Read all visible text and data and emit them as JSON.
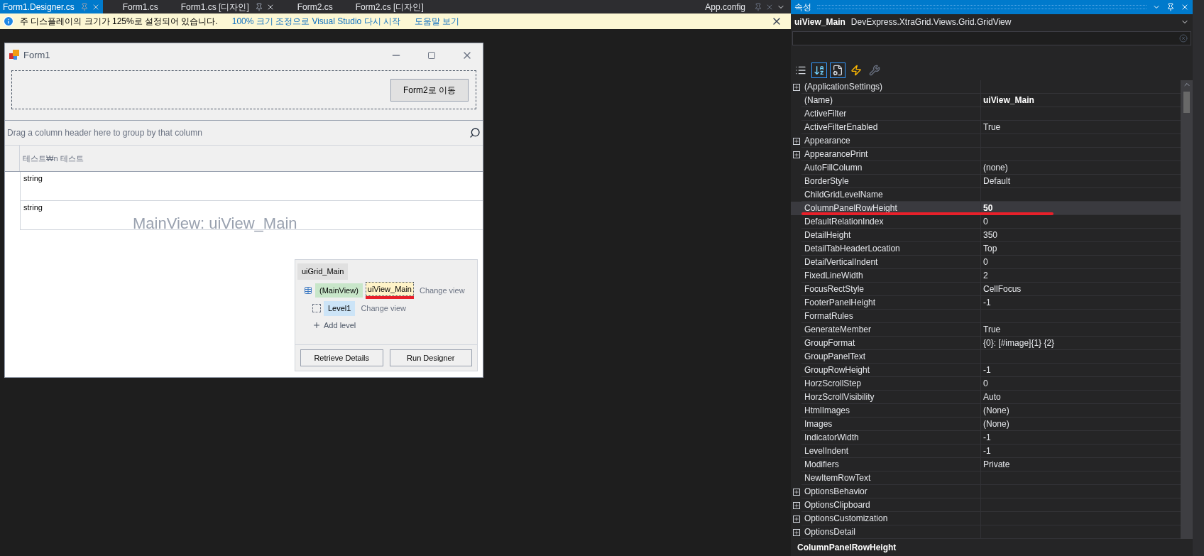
{
  "tabs": [
    {
      "label": "Form1.Designer.cs",
      "selected": true,
      "closable": true
    },
    {
      "label": "Form1.cs",
      "selected": false,
      "closable": false
    },
    {
      "label": "Form1.cs [디자인]",
      "selected": false,
      "closable": true
    },
    {
      "label": "Form2.cs",
      "selected": false,
      "closable": false
    },
    {
      "label": "Form2.cs [디자인]",
      "selected": false,
      "closable": false
    }
  ],
  "right_tab": {
    "label": "App.config"
  },
  "info_bar": {
    "message": "주 디스플레이의 크기가 125%로 설정되어 있습니다.",
    "links": [
      "100% 크기 조정으로 Visual Studio 다시 시작",
      "도움말 보기"
    ]
  },
  "form": {
    "title": "Form1",
    "button": "Form2로 이동",
    "grid": {
      "group_panel_text": "Drag a column header here to group by that column",
      "columns": [
        "테스트₩n 테스트"
      ],
      "rows": [
        "string",
        "string"
      ],
      "overlay": "MainView: uiView_Main"
    },
    "designer": {
      "grid_name": "uiGrid_Main",
      "levels": [
        {
          "label": "(MainView)",
          "color": "#c8e6c9",
          "view": {
            "label": "uiView_Main",
            "underlined": true
          },
          "action": "Change view"
        },
        {
          "label": "Level1",
          "color": "#cce4f7",
          "action": "Change view"
        }
      ],
      "add_level": "Add level",
      "buttons": [
        "Retrieve Details",
        "Run Designer"
      ]
    }
  },
  "properties": {
    "title": "속성",
    "object_name": "uiView_Main",
    "object_type": "DevExpress.XtraGrid.Views.Grid.GridView",
    "toolbar": [
      {
        "kind": "categorized",
        "selected": false
      },
      {
        "kind": "alphabetical",
        "selected": true
      },
      {
        "kind": "properties",
        "selected": true
      },
      {
        "kind": "events",
        "selected": false
      },
      {
        "kind": "pages",
        "selected": false
      }
    ],
    "rows": [
      {
        "name": "(ApplicationSettings)",
        "expandable": true,
        "selected": false,
        "underlined": false
      },
      {
        "name": "(Name)",
        "value": "uiView_Main",
        "expandable": false,
        "modified": true,
        "selected": false,
        "underlined": false
      },
      {
        "name": "ActiveFilter",
        "expandable": false,
        "selected": false,
        "underlined": false
      },
      {
        "name": "ActiveFilterEnabled",
        "value": "True",
        "expandable": false,
        "modified": false,
        "selected": false,
        "underlined": false
      },
      {
        "name": "Appearance",
        "expandable": true,
        "selected": false,
        "underlined": false
      },
      {
        "name": "AppearancePrint",
        "expandable": true,
        "selected": false,
        "underlined": false
      },
      {
        "name": "AutoFillColumn",
        "value": "(none)",
        "expandable": false,
        "modified": false,
        "selected": false,
        "underlined": false
      },
      {
        "name": "BorderStyle",
        "value": "Default",
        "expandable": false,
        "modified": false,
        "selected": false,
        "underlined": false
      },
      {
        "name": "ChildGridLevelName",
        "expandable": false,
        "selected": false,
        "underlined": false
      },
      {
        "name": "ColumnPanelRowHeight",
        "value": "50",
        "expandable": false,
        "modified": true,
        "selected": true,
        "underlined": true
      },
      {
        "name": "DefaultRelationIndex",
        "value": "0",
        "expandable": false,
        "modified": false,
        "selected": false,
        "underlined": false
      },
      {
        "name": "DetailHeight",
        "value": "350",
        "expandable": false,
        "modified": false,
        "selected": false,
        "underlined": false
      },
      {
        "name": "DetailTabHeaderLocation",
        "value": "Top",
        "expandable": false,
        "modified": false,
        "selected": false,
        "underlined": false
      },
      {
        "name": "DetailVerticalIndent",
        "value": "0",
        "expandable": false,
        "modified": false,
        "selected": false,
        "underlined": false
      },
      {
        "name": "FixedLineWidth",
        "value": "2",
        "expandable": false,
        "modified": false,
        "selected": false,
        "underlined": false
      },
      {
        "name": "FocusRectStyle",
        "value": "CellFocus",
        "expandable": false,
        "modified": false,
        "selected": false,
        "underlined": false
      },
      {
        "name": "FooterPanelHeight",
        "value": "-1",
        "expandable": false,
        "modified": false,
        "selected": false,
        "underlined": false
      },
      {
        "name": "FormatRules",
        "expandable": false,
        "selected": false,
        "underlined": false
      },
      {
        "name": "GenerateMember",
        "value": "True",
        "expandable": false,
        "modified": false,
        "selected": false,
        "underlined": false
      },
      {
        "name": "GroupFormat",
        "value": "{0}: [#image]{1} {2}",
        "expandable": false,
        "modified": false,
        "selected": false,
        "underlined": false
      },
      {
        "name": "GroupPanelText",
        "expandable": false,
        "selected": false,
        "underlined": false
      },
      {
        "name": "GroupRowHeight",
        "value": "-1",
        "expandable": false,
        "modified": false,
        "selected": false,
        "underlined": false
      },
      {
        "name": "HorzScrollStep",
        "value": "0",
        "expandable": false,
        "modified": false,
        "selected": false,
        "underlined": false
      },
      {
        "name": "HorzScrollVisibility",
        "value": "Auto",
        "expandable": false,
        "modified": false,
        "selected": false,
        "underlined": false
      },
      {
        "name": "HtmlImages",
        "value": "(None)",
        "expandable": false,
        "modified": false,
        "selected": false,
        "underlined": false
      },
      {
        "name": "Images",
        "value": "(None)",
        "expandable": false,
        "modified": false,
        "selected": false,
        "underlined": false
      },
      {
        "name": "IndicatorWidth",
        "value": "-1",
        "expandable": false,
        "modified": false,
        "selected": false,
        "underlined": false
      },
      {
        "name": "LevelIndent",
        "value": "-1",
        "expandable": false,
        "modified": false,
        "selected": false,
        "underlined": false
      },
      {
        "name": "Modifiers",
        "value": "Private",
        "expandable": false,
        "modified": false,
        "selected": false,
        "underlined": false
      },
      {
        "name": "NewItemRowText",
        "expandable": false,
        "selected": false,
        "underlined": false
      },
      {
        "name": "OptionsBehavior",
        "expandable": true,
        "selected": false,
        "underlined": false
      },
      {
        "name": "OptionsClipboard",
        "expandable": true,
        "selected": false,
        "underlined": false
      },
      {
        "name": "OptionsCustomization",
        "expandable": true,
        "selected": false,
        "underlined": false
      },
      {
        "name": "OptionsDetail",
        "expandable": true,
        "selected": false,
        "underlined": false
      }
    ],
    "description_title": "ColumnPanelRowHeight"
  }
}
